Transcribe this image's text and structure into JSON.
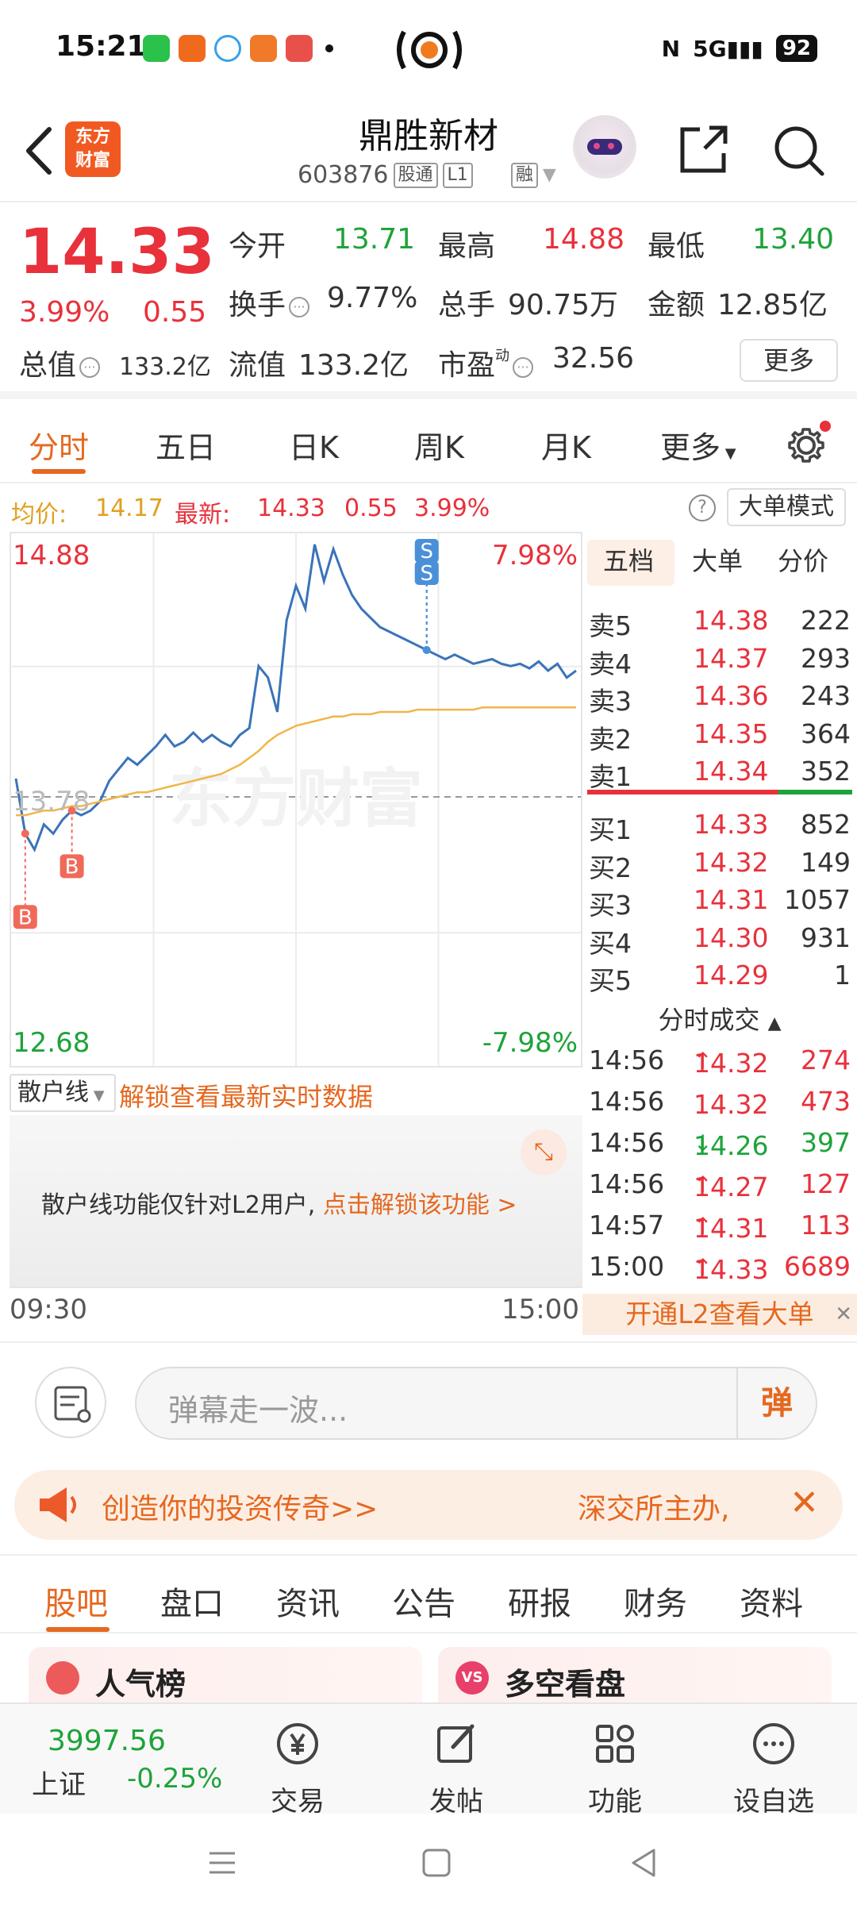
{
  "status_bar": {
    "time": "15:21",
    "signal": "5G",
    "battery": "92"
  },
  "header": {
    "title": "鼎胜新材",
    "code": "603876",
    "tags": [
      "股通",
      "L1",
      "融"
    ],
    "logo_text_1": "东方",
    "logo_text_2": "财富"
  },
  "quote": {
    "price": "14.33",
    "pct": "3.99%",
    "change": "0.55",
    "open_label": "今开",
    "open": "13.71",
    "high_label": "最高",
    "high": "14.88",
    "low_label": "最低",
    "low": "13.40",
    "turnover_label": "换手",
    "turnover": "9.77%",
    "volume_label": "总手",
    "volume": "90.75万",
    "amount_label": "金额",
    "amount": "12.85亿",
    "mktcap_label": "总值",
    "mktcap": "133.2亿",
    "float_label": "流值",
    "float": "133.2亿",
    "pe_label": "市盈",
    "pe_sup": "动",
    "pe": "32.56",
    "more": "更多"
  },
  "period_tabs": [
    "分时",
    "五日",
    "日K",
    "周K",
    "月K",
    "更多"
  ],
  "info_line": {
    "avg_label": "均价:",
    "avg": "14.17",
    "latest_label": "最新:",
    "latest": "14.33",
    "chg": "0.55",
    "pct": "3.99%",
    "big_mode": "大单模式"
  },
  "chart_data": {
    "type": "line",
    "y_top": "14.88",
    "y_bottom": "12.68",
    "y_mid": "13.78",
    "pct_top": "7.98%",
    "pct_bottom": "-7.98%",
    "ylim": [
      12.68,
      14.88
    ],
    "x_start": "09:30",
    "x_end": "15:00",
    "series": [
      {
        "values": [
          13.86,
          13.62,
          13.55,
          13.66,
          13.62,
          13.68,
          13.72,
          13.7,
          13.72,
          13.76,
          13.85,
          13.9,
          13.95,
          13.92,
          13.96,
          14.0,
          14.05,
          14.0,
          14.02,
          14.06,
          14.02,
          14.05,
          14.02,
          14.0,
          14.05,
          14.08,
          14.35,
          14.3,
          14.15,
          14.55,
          14.7,
          14.6,
          14.88,
          14.72,
          14.86,
          14.75,
          14.66,
          14.6,
          14.56,
          14.52,
          14.5,
          14.48,
          14.46,
          14.44,
          14.42,
          14.4,
          14.38,
          14.4,
          14.38,
          14.36,
          14.37,
          14.38,
          14.36,
          14.35,
          14.36,
          14.34,
          14.37,
          14.33,
          14.36,
          14.3,
          14.33
        ]
      },
      {
        "values": [
          13.7,
          13.7,
          13.71,
          13.72,
          13.72,
          13.73,
          13.74,
          13.74,
          13.75,
          13.76,
          13.77,
          13.78,
          13.79,
          13.8,
          13.8,
          13.81,
          13.82,
          13.83,
          13.84,
          13.85,
          13.86,
          13.87,
          13.88,
          13.9,
          13.92,
          13.95,
          13.98,
          14.02,
          14.05,
          14.07,
          14.09,
          14.1,
          14.11,
          14.12,
          14.13,
          14.13,
          14.14,
          14.14,
          14.14,
          14.15,
          14.15,
          14.15,
          14.15,
          14.16,
          14.16,
          14.16,
          14.16,
          14.16,
          14.16,
          14.16,
          14.17,
          14.17,
          14.17,
          14.17,
          14.17,
          14.17,
          14.17,
          14.17,
          14.17,
          14.17,
          14.17
        ]
      }
    ],
    "markers": [
      {
        "label": "B",
        "index": 1
      },
      {
        "label": "B",
        "index": 6
      },
      {
        "label": "S",
        "index": 44
      },
      {
        "label": "S",
        "index": 44
      }
    ]
  },
  "order_book": {
    "tabs": [
      "五档",
      "大单",
      "分价"
    ],
    "asks": [
      {
        "label": "卖5",
        "price": "14.38",
        "vol": "222"
      },
      {
        "label": "卖4",
        "price": "14.37",
        "vol": "293"
      },
      {
        "label": "卖3",
        "price": "14.36",
        "vol": "243"
      },
      {
        "label": "卖2",
        "price": "14.35",
        "vol": "364"
      },
      {
        "label": "卖1",
        "price": "14.34",
        "vol": "352"
      }
    ],
    "bids": [
      {
        "label": "买1",
        "price": "14.33",
        "vol": "852"
      },
      {
        "label": "买2",
        "price": "14.32",
        "vol": "149"
      },
      {
        "label": "买3",
        "price": "14.31",
        "vol": "1057"
      },
      {
        "label": "买4",
        "price": "14.30",
        "vol": "931"
      },
      {
        "label": "买5",
        "price": "14.29",
        "vol": "1"
      }
    ],
    "trades_title": "分时成交",
    "trades": [
      {
        "time": "14:56",
        "price": "14.32",
        "arrow": "↑",
        "vol": "274",
        "dir": "up"
      },
      {
        "time": "14:56",
        "price": "14.32",
        "arrow": "",
        "vol": "473",
        "dir": "up"
      },
      {
        "time": "14:56",
        "price": "14.26",
        "arrow": "↓",
        "vol": "397",
        "dir": "down"
      },
      {
        "time": "14:56",
        "price": "14.27",
        "arrow": "↑",
        "vol": "127",
        "dir": "up"
      },
      {
        "time": "14:57",
        "price": "14.31",
        "arrow": "↑",
        "vol": "113",
        "dir": "up"
      },
      {
        "time": "15:00",
        "price": "14.33",
        "arrow": "↑",
        "vol": "6689",
        "dir": "up"
      }
    ],
    "l2_banner": "开通L2查看大单"
  },
  "retail": {
    "select": "散户线",
    "unlock": "解锁查看最新实时数据",
    "msg": "散户线功能仅针对L2用户,",
    "msg_link": "点击解锁该功能 >"
  },
  "danmaku": {
    "placeholder": "弹幕走一波...",
    "button": "弹"
  },
  "promo": {
    "left": "创造你的投资传奇>>",
    "right": "深交所主办,"
  },
  "community_tabs": [
    "股吧",
    "盘口",
    "资讯",
    "公告",
    "研报",
    "财务",
    "资料"
  ],
  "cards": {
    "left": "人气榜",
    "right": "多空看盘"
  },
  "bottom_bar": {
    "index_value": "3997.56",
    "index_name": "上证",
    "index_pct": "-0.25%",
    "items": [
      "交易",
      "发帖",
      "功能",
      "设自选"
    ]
  },
  "colors": {
    "up": "#e8313b",
    "down": "#1ea33a",
    "accent": "#e5681f",
    "price_line": "#3b73b9",
    "avg_line": "#f0b64a"
  }
}
